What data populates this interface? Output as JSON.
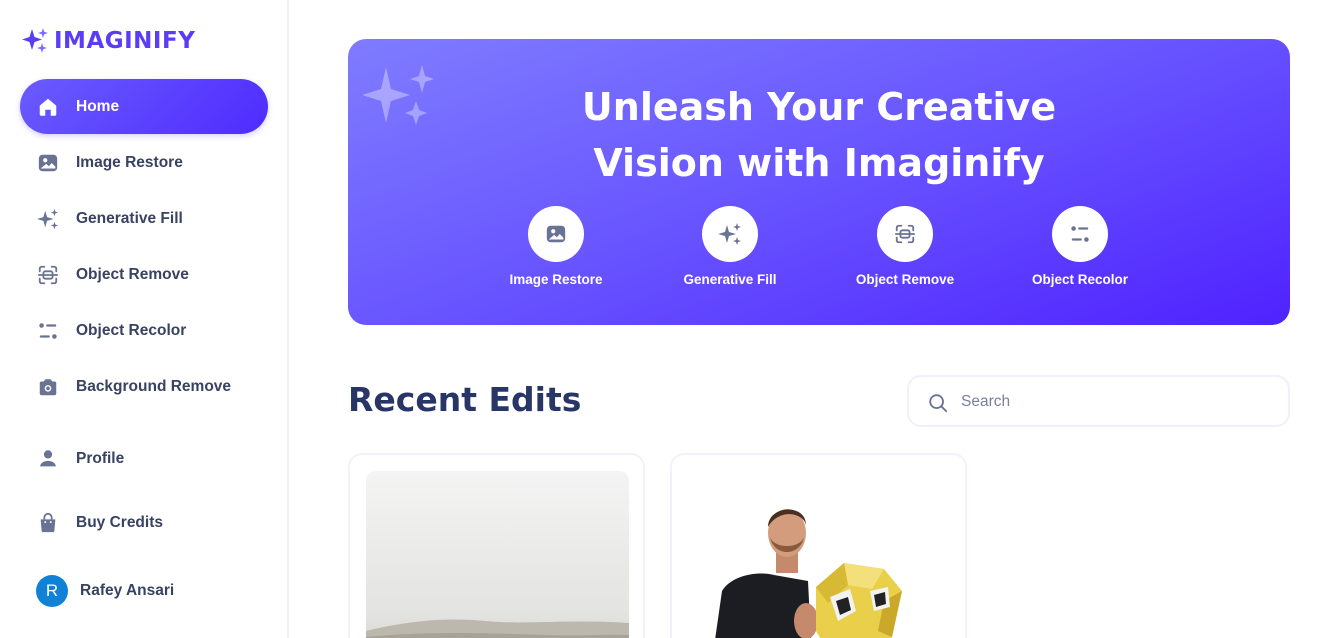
{
  "app": {
    "name": "IMAGINIFY",
    "brand_color": "#5b3df5"
  },
  "sidebar": {
    "items": [
      {
        "label": "Home",
        "icon": "home-icon",
        "active": true
      },
      {
        "label": "Image Restore",
        "icon": "image-icon"
      },
      {
        "label": "Generative Fill",
        "icon": "stars-icon"
      },
      {
        "label": "Object Remove",
        "icon": "scan-icon"
      },
      {
        "label": "Object Recolor",
        "icon": "filter-icon"
      },
      {
        "label": "Background Remove",
        "icon": "camera-icon"
      },
      {
        "label": "Profile",
        "icon": "user-icon"
      },
      {
        "label": "Buy Credits",
        "icon": "bag-icon"
      }
    ],
    "user": {
      "initial": "R",
      "name": "Rafey Ansari"
    }
  },
  "hero": {
    "title_line1": "Unleash Your Creative",
    "title_line2": "Vision with Imaginify",
    "features": [
      {
        "label": "Image Restore",
        "icon": "image-icon"
      },
      {
        "label": "Generative Fill",
        "icon": "stars-icon"
      },
      {
        "label": "Object Remove",
        "icon": "scan-icon"
      },
      {
        "label": "Object Recolor",
        "icon": "filter-icon"
      }
    ]
  },
  "recent": {
    "title": "Recent Edits",
    "search_placeholder": "Search"
  }
}
